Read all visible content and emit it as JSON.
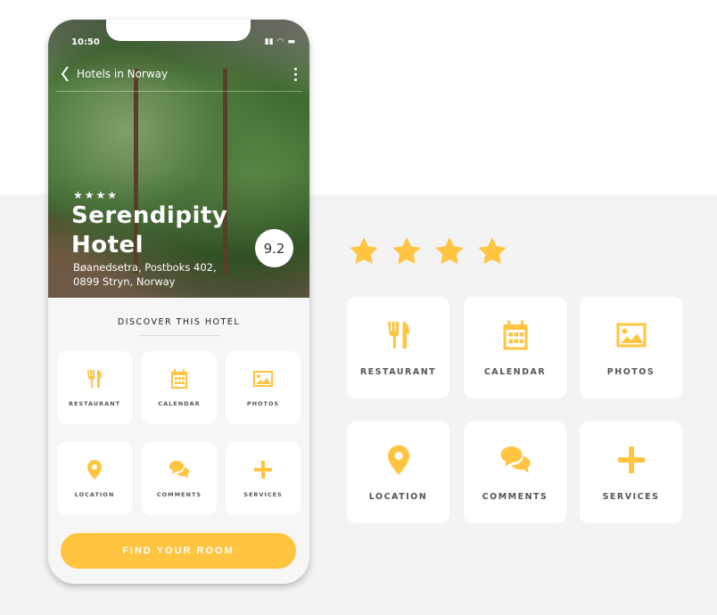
{
  "phone": {
    "time": "10:50",
    "nav_title": "Hotels in Norway",
    "hotel_stars": 4,
    "hotel_name_line1": "Serendipity",
    "hotel_name_line2": "Hotel",
    "address_line1": "Bøanedsetra, Postboks 402,",
    "address_line2": "0899 Stryn, Norway",
    "score": "9.2",
    "section_title": "DISCOVER THIS HOTEL",
    "cta": "FIND YOUR ROOM"
  },
  "features": [
    {
      "label": "RESTAURANT",
      "icon": "restaurant"
    },
    {
      "label": "CALENDAR",
      "icon": "calendar"
    },
    {
      "label": "PHOTOS",
      "icon": "photos"
    },
    {
      "label": "LOCATION",
      "icon": "location"
    },
    {
      "label": "COMMENTS",
      "icon": "comments"
    },
    {
      "label": "SERVICES",
      "icon": "plus"
    }
  ],
  "showcase": {
    "stars": 4
  },
  "colors": {
    "accent": "#ffc440",
    "background": "#f3f3f3"
  }
}
